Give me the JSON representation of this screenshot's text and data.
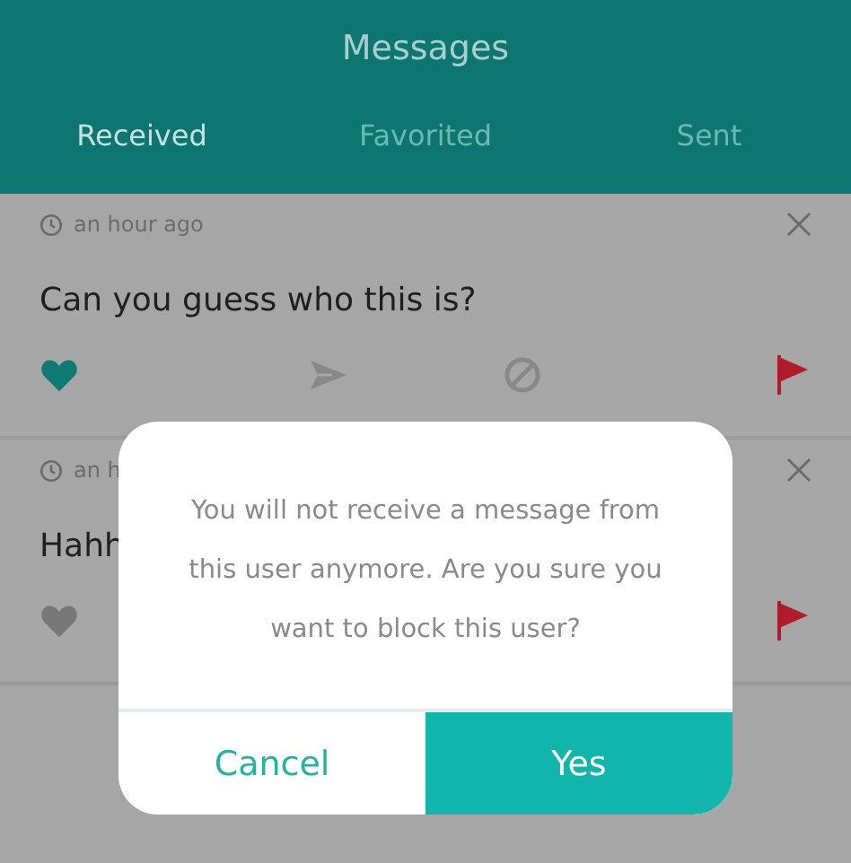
{
  "header": {
    "title": "Messages"
  },
  "tabs": [
    {
      "label": "Received",
      "selected": true
    },
    {
      "label": "Favorited",
      "selected": false
    },
    {
      "label": "Sent",
      "selected": false
    }
  ],
  "messages": [
    {
      "time": "an hour ago",
      "text": "Can you guess who this is?",
      "favorited": true,
      "actions": [
        {
          "kind": "favorite"
        },
        {
          "kind": "forward"
        },
        {
          "kind": "block"
        },
        {
          "kind": "report"
        }
      ]
    },
    {
      "time": "an h",
      "text": "Hahh",
      "favorited": false,
      "actions": [
        {
          "kind": "favorite"
        },
        {
          "kind": "report"
        }
      ]
    }
  ],
  "dialog": {
    "message": "You will not receive a message from this user anymore. Are you sure you want to block this user?",
    "buttons": [
      {
        "label": "Cancel",
        "kind": "secondary"
      },
      {
        "label": "Yes",
        "kind": "primary"
      }
    ]
  }
}
